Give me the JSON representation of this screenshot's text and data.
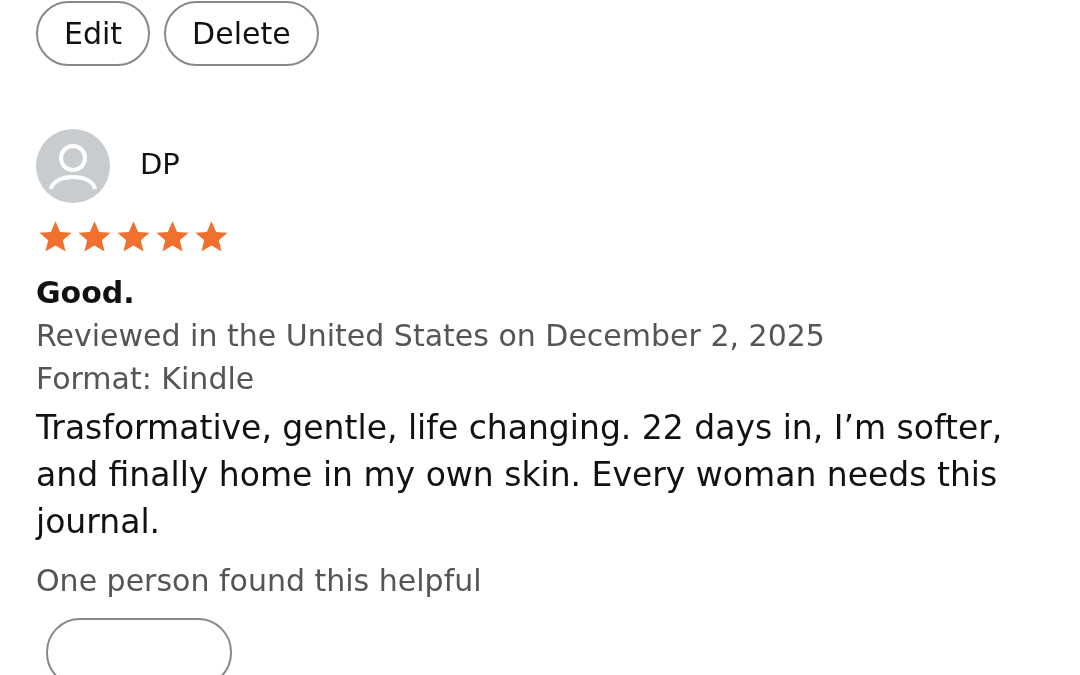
{
  "actions": [
    "Edit",
    "Delete"
  ],
  "review": {
    "author": "DP",
    "stars": 5,
    "title": "Good.",
    "meta": "Reviewed in the United States on December 2, 2025",
    "format": "Format: Kindle",
    "body": "Trasformative, gentle, life changing. 22 days in, I’m softer, and finally home in my own skin. Every woman needs this journal.",
    "helpful": "One person found this helpful"
  }
}
